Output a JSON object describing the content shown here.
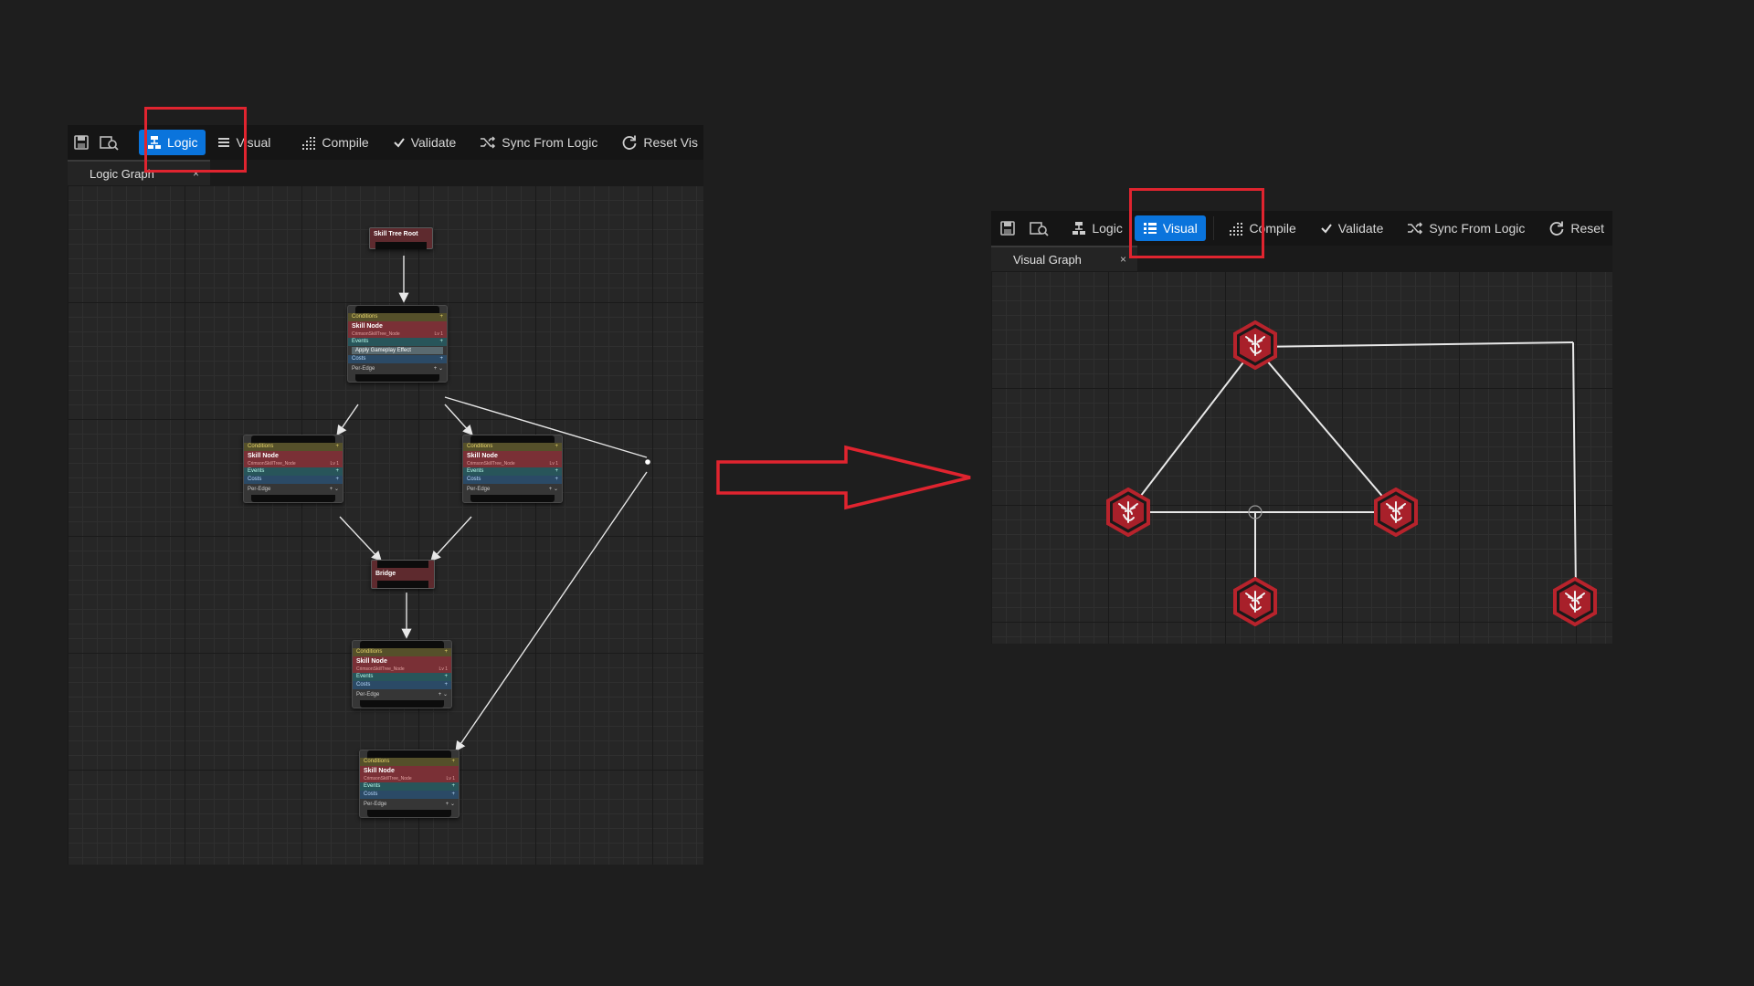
{
  "left": {
    "toolbar": {
      "save_icon": "save-icon",
      "browse_icon": "browse-icon",
      "logic_label": "Logic",
      "visual_label": "Visual",
      "compile_label": "Compile",
      "validate_label": "Validate",
      "sync_label": "Sync From Logic",
      "reset_label": "Reset Vis"
    },
    "tab": {
      "label": "Logic Graph",
      "close": "×"
    },
    "nodes": {
      "root": "Skill Tree Root",
      "bridge": "Bridge",
      "conditions": "Conditions",
      "skill_title": "Skill Node",
      "skill_sub": "CrimsonSkillTree_Node",
      "level": "Lv 1",
      "events": "Events",
      "effect": "Apply Gameplay Effect",
      "costs": "Costs",
      "per_edge": "Per-Edge"
    }
  },
  "right": {
    "toolbar": {
      "logic_label": "Logic",
      "visual_label": "Visual",
      "compile_label": "Compile",
      "validate_label": "Validate",
      "sync_label": "Sync From Logic",
      "reset_label": "Reset"
    },
    "tab": {
      "label": "Visual Graph",
      "close": "×"
    }
  },
  "colors": {
    "accent": "#0a74dc",
    "highlight": "#e0242f",
    "skill_red": "#b8232c"
  }
}
